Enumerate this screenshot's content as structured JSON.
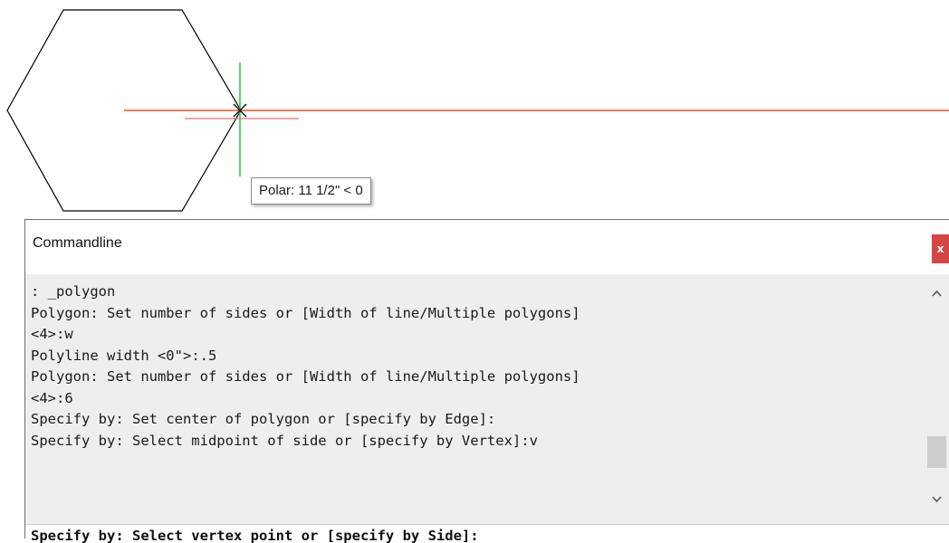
{
  "tooltip": {
    "polar_text": "Polar: 11 1/2\" < 0"
  },
  "colors": {
    "tracking_line": "#ff4a1a",
    "crosshair_vertical": "#22d04a",
    "crosshair_horizontal": "#ee6a6a",
    "close_button": "#d64545",
    "history_background": "#eeeeee"
  },
  "commandline": {
    "title": "Commandline",
    "close_label": "x",
    "history": [
      ": _polygon",
      "Polygon: Set number of sides or [Width of line/Multiple polygons]",
      "<4>:w",
      "Polyline width <0\">:.5",
      "Polygon: Set number of sides or [Width of line/Multiple polygons]",
      "<4>:6",
      "Specify by: Set center of polygon or [specify by Edge]:",
      "Specify by: Select midpoint of side or [specify by Vertex]:v"
    ],
    "current_prompt": "Specify by: Select vertex point or [specify by Side]:",
    "scroll_up_icon": "chevron-up-icon",
    "scroll_down_icon": "chevron-down-icon"
  }
}
